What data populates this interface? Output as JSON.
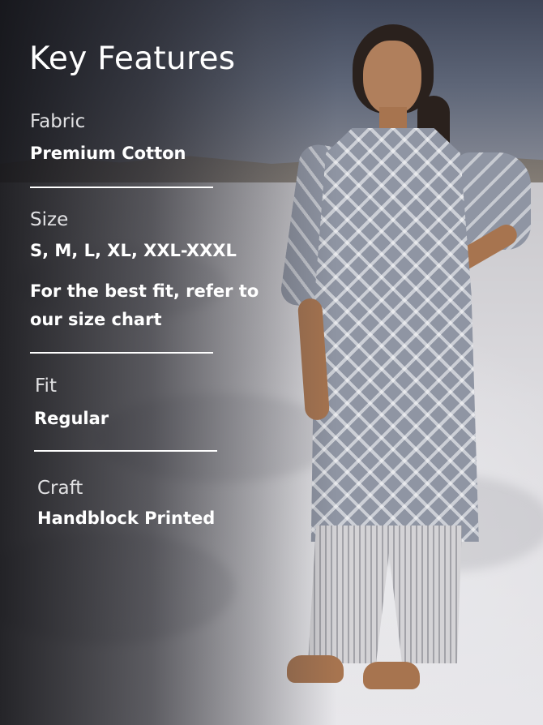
{
  "title": "Key Features",
  "features": [
    {
      "label": "Fabric",
      "value": "Premium Cotton"
    },
    {
      "label": "Size",
      "value": "S, M, L, XL, XXL-XXXL",
      "note": "For the best fit, refer to our size chart"
    },
    {
      "label": "Fit",
      "value": "Regular"
    },
    {
      "label": "Craft",
      "value": "Handblock Printed"
    }
  ]
}
